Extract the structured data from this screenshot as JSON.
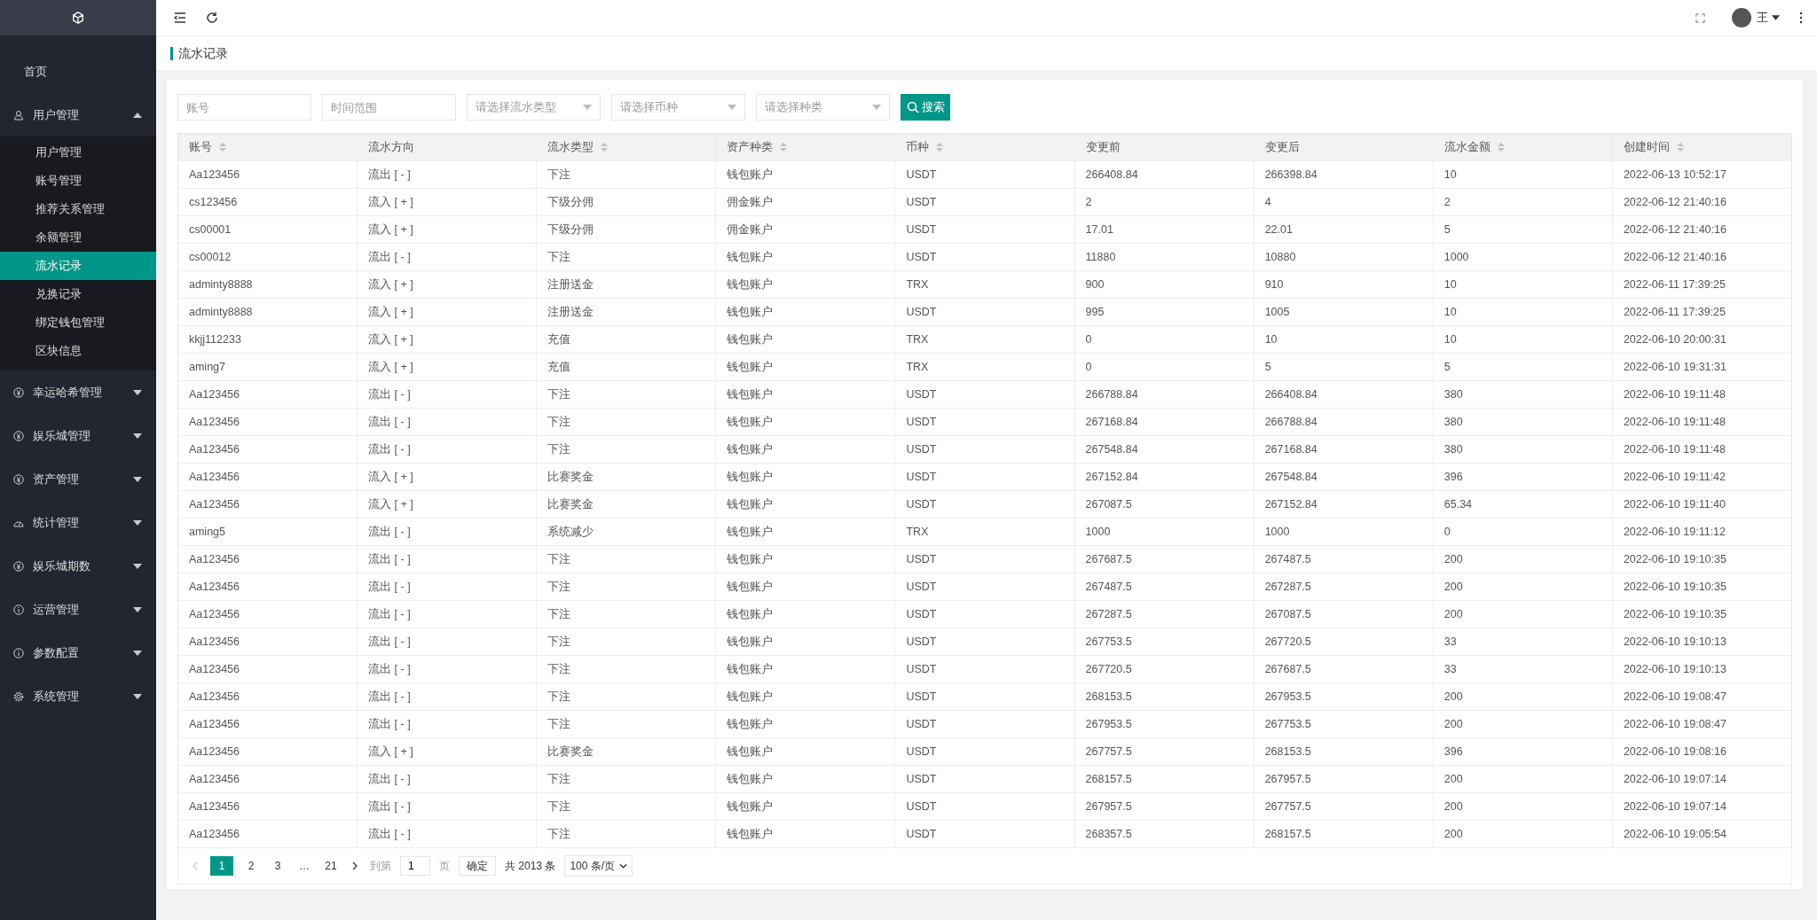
{
  "sidebar": {
    "items": [
      {
        "kind": "link",
        "label": "首页",
        "selected": false
      },
      {
        "kind": "group",
        "label": "用户管理",
        "expanded": true,
        "children": [
          {
            "label": "用户管理",
            "selected": false
          },
          {
            "label": "账号管理",
            "selected": false
          },
          {
            "label": "推荐关系管理",
            "selected": false
          },
          {
            "label": "余额管理",
            "selected": false
          },
          {
            "label": "流水记录",
            "selected": true
          },
          {
            "label": "兑换记录",
            "selected": false
          },
          {
            "label": "绑定钱包管理",
            "selected": false
          },
          {
            "label": "区块信息",
            "selected": false
          }
        ]
      },
      {
        "kind": "group",
        "label": "幸运哈希管理",
        "expanded": false
      },
      {
        "kind": "group",
        "label": "娱乐城管理",
        "expanded": false
      },
      {
        "kind": "group",
        "label": "资产管理",
        "expanded": false
      },
      {
        "kind": "group",
        "label": "统计管理",
        "expanded": false
      },
      {
        "kind": "group",
        "label": "娱乐城期数",
        "expanded": false
      },
      {
        "kind": "group",
        "label": "运营管理",
        "expanded": false
      },
      {
        "kind": "group",
        "label": "参数配置",
        "expanded": false
      },
      {
        "kind": "group",
        "label": "系统管理",
        "expanded": false
      }
    ]
  },
  "header": {
    "user": "王"
  },
  "breadcrumb": "流水记录",
  "filters": [
    {
      "kind": "input",
      "placeholder": "账号"
    },
    {
      "kind": "input",
      "placeholder": "时间范围"
    },
    {
      "kind": "select",
      "placeholder": "请选择流水类型"
    },
    {
      "kind": "select",
      "placeholder": "请选择币种"
    },
    {
      "kind": "select",
      "placeholder": "请选择种类"
    }
  ],
  "search_button": "搜索",
  "table": {
    "columns": [
      {
        "label": "账号",
        "sortable": true
      },
      {
        "label": "流水方向",
        "sortable": false
      },
      {
        "label": "流水类型",
        "sortable": true
      },
      {
        "label": "资产种类",
        "sortable": true
      },
      {
        "label": "币种",
        "sortable": true
      },
      {
        "label": "变更前",
        "sortable": false
      },
      {
        "label": "变更后",
        "sortable": false
      },
      {
        "label": "流水金额",
        "sortable": true
      },
      {
        "label": "创建时间",
        "sortable": true
      }
    ],
    "rows": [
      [
        "Aa123456",
        "流出 [ - ]",
        "下注",
        "钱包账户",
        "USDT",
        "266408.84",
        "266398.84",
        "10",
        "2022-06-13 10:52:17"
      ],
      [
        "cs123456",
        "流入 [ + ]",
        "下级分佣",
        "佣金账户",
        "USDT",
        "2",
        "4",
        "2",
        "2022-06-12 21:40:16"
      ],
      [
        "cs00001",
        "流入 [ + ]",
        "下级分佣",
        "佣金账户",
        "USDT",
        "17.01",
        "22.01",
        "5",
        "2022-06-12 21:40:16"
      ],
      [
        "cs00012",
        "流出 [ - ]",
        "下注",
        "钱包账户",
        "USDT",
        "11880",
        "10880",
        "1000",
        "2022-06-12 21:40:16"
      ],
      [
        "adminty8888",
        "流入 [ + ]",
        "注册送金",
        "钱包账户",
        "TRX",
        "900",
        "910",
        "10",
        "2022-06-11 17:39:25"
      ],
      [
        "adminty8888",
        "流入 [ + ]",
        "注册送金",
        "钱包账户",
        "USDT",
        "995",
        "1005",
        "10",
        "2022-06-11 17:39:25"
      ],
      [
        "kkjj112233",
        "流入 [ + ]",
        "充值",
        "钱包账户",
        "TRX",
        "0",
        "10",
        "10",
        "2022-06-10 20:00:31"
      ],
      [
        "aming7",
        "流入 [ + ]",
        "充值",
        "钱包账户",
        "TRX",
        "0",
        "5",
        "5",
        "2022-06-10 19:31:31"
      ],
      [
        "Aa123456",
        "流出 [ - ]",
        "下注",
        "钱包账户",
        "USDT",
        "266788.84",
        "266408.84",
        "380",
        "2022-06-10 19:11:48"
      ],
      [
        "Aa123456",
        "流出 [ - ]",
        "下注",
        "钱包账户",
        "USDT",
        "267168.84",
        "266788.84",
        "380",
        "2022-06-10 19:11:48"
      ],
      [
        "Aa123456",
        "流出 [ - ]",
        "下注",
        "钱包账户",
        "USDT",
        "267548.84",
        "267168.84",
        "380",
        "2022-06-10 19:11:48"
      ],
      [
        "Aa123456",
        "流入 [ + ]",
        "比赛奖金",
        "钱包账户",
        "USDT",
        "267152.84",
        "267548.84",
        "396",
        "2022-06-10 19:11:42"
      ],
      [
        "Aa123456",
        "流入 [ + ]",
        "比赛奖金",
        "钱包账户",
        "USDT",
        "267087.5",
        "267152.84",
        "65.34",
        "2022-06-10 19:11:40"
      ],
      [
        "aming5",
        "流出 [ - ]",
        "系统减少",
        "钱包账户",
        "TRX",
        "1000",
        "1000",
        "0",
        "2022-06-10 19:11:12"
      ],
      [
        "Aa123456",
        "流出 [ - ]",
        "下注",
        "钱包账户",
        "USDT",
        "267687.5",
        "267487.5",
        "200",
        "2022-06-10 19:10:35"
      ],
      [
        "Aa123456",
        "流出 [ - ]",
        "下注",
        "钱包账户",
        "USDT",
        "267487.5",
        "267287.5",
        "200",
        "2022-06-10 19:10:35"
      ],
      [
        "Aa123456",
        "流出 [ - ]",
        "下注",
        "钱包账户",
        "USDT",
        "267287.5",
        "267087.5",
        "200",
        "2022-06-10 19:10:35"
      ],
      [
        "Aa123456",
        "流出 [ - ]",
        "下注",
        "钱包账户",
        "USDT",
        "267753.5",
        "267720.5",
        "33",
        "2022-06-10 19:10:13"
      ],
      [
        "Aa123456",
        "流出 [ - ]",
        "下注",
        "钱包账户",
        "USDT",
        "267720.5",
        "267687.5",
        "33",
        "2022-06-10 19:10:13"
      ],
      [
        "Aa123456",
        "流出 [ - ]",
        "下注",
        "钱包账户",
        "USDT",
        "268153.5",
        "267953.5",
        "200",
        "2022-06-10 19:08:47"
      ],
      [
        "Aa123456",
        "流出 [ - ]",
        "下注",
        "钱包账户",
        "USDT",
        "267953.5",
        "267753.5",
        "200",
        "2022-06-10 19:08:47"
      ],
      [
        "Aa123456",
        "流入 [ + ]",
        "比赛奖金",
        "钱包账户",
        "USDT",
        "267757.5",
        "268153.5",
        "396",
        "2022-06-10 19:08:16"
      ],
      [
        "Aa123456",
        "流出 [ - ]",
        "下注",
        "钱包账户",
        "USDT",
        "268157.5",
        "267957.5",
        "200",
        "2022-06-10 19:07:14"
      ],
      [
        "Aa123456",
        "流出 [ - ]",
        "下注",
        "钱包账户",
        "USDT",
        "267957.5",
        "267757.5",
        "200",
        "2022-06-10 19:07:14"
      ],
      [
        "Aa123456",
        "流出 [ - ]",
        "下注",
        "钱包账户",
        "USDT",
        "268357.5",
        "268157.5",
        "200",
        "2022-06-10 19:05:54"
      ]
    ]
  },
  "pagination": {
    "prev_disabled": true,
    "pages": [
      {
        "label": "1",
        "selected": true
      },
      {
        "label": "2",
        "selected": false
      },
      {
        "label": "3",
        "selected": false
      },
      {
        "label": "…",
        "selected": false
      },
      {
        "label": "21",
        "selected": false
      }
    ],
    "goto_label": "到第",
    "goto_value": "1",
    "page_unit": "页",
    "confirm": "确定",
    "total": "共 2013 条",
    "page_size": "100 条/页"
  }
}
